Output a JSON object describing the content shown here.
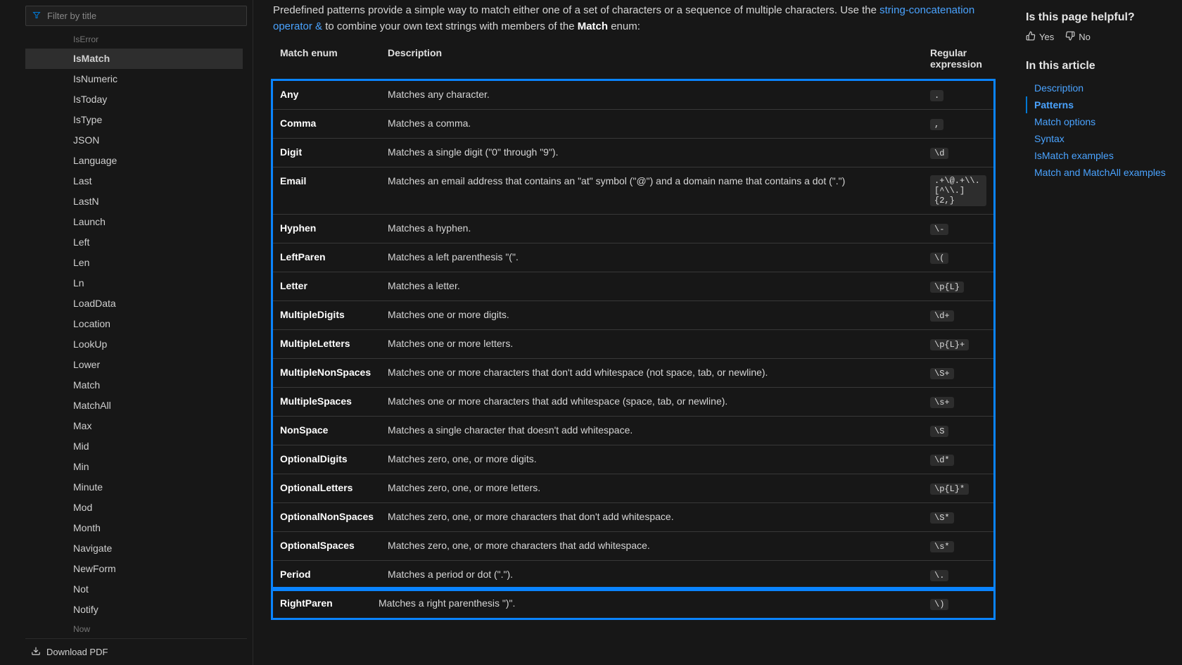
{
  "sidebar": {
    "filter_placeholder": "Filter by title",
    "items": [
      {
        "label": "IsError",
        "active": false,
        "partial": true
      },
      {
        "label": "IsMatch",
        "active": true
      },
      {
        "label": "IsNumeric"
      },
      {
        "label": "IsToday"
      },
      {
        "label": "IsType"
      },
      {
        "label": "JSON"
      },
      {
        "label": "Language"
      },
      {
        "label": "Last"
      },
      {
        "label": "LastN"
      },
      {
        "label": "Launch"
      },
      {
        "label": "Left"
      },
      {
        "label": "Len"
      },
      {
        "label": "Ln"
      },
      {
        "label": "LoadData"
      },
      {
        "label": "Location"
      },
      {
        "label": "LookUp"
      },
      {
        "label": "Lower"
      },
      {
        "label": "Match"
      },
      {
        "label": "MatchAll"
      },
      {
        "label": "Max"
      },
      {
        "label": "Mid"
      },
      {
        "label": "Min"
      },
      {
        "label": "Minute"
      },
      {
        "label": "Mod"
      },
      {
        "label": "Month"
      },
      {
        "label": "Navigate"
      },
      {
        "label": "NewForm"
      },
      {
        "label": "Not"
      },
      {
        "label": "Notify"
      },
      {
        "label": "Now",
        "partial": true
      }
    ],
    "download_label": "Download PDF"
  },
  "content": {
    "intro_pre": "Predefined patterns provide a simple way to match either one of a set of characters or a sequence of multiple characters. Use the ",
    "intro_link": "string-concatenation operator &",
    "intro_post_1": " to combine your own text strings with members of the ",
    "intro_bold": "Match",
    "intro_post_2": " enum:",
    "headers": {
      "enum": "Match enum",
      "desc": "Description",
      "regex": "Regular expression"
    },
    "rows": [
      {
        "enum": "Any",
        "desc": "Matches any character.",
        "regex": "."
      },
      {
        "enum": "Comma",
        "desc": "Matches a comma.",
        "regex": ","
      },
      {
        "enum": "Digit",
        "desc": "Matches a single digit (\"0\" through \"9\").",
        "regex": "\\d"
      },
      {
        "enum": "Email",
        "desc": "Matches an email address that contains an \"at\" symbol (\"@\") and a domain name that contains a dot (\".\")",
        "regex": ".+\\@.+\\\\.[^\\\\.]{2,}"
      },
      {
        "enum": "Hyphen",
        "desc": "Matches a hyphen.",
        "regex": "\\-"
      },
      {
        "enum": "LeftParen",
        "desc": "Matches a left parenthesis \"(\".",
        "regex": "\\("
      },
      {
        "enum": "Letter",
        "desc": "Matches a letter.",
        "regex": "\\p{L}"
      },
      {
        "enum": "MultipleDigits",
        "desc": "Matches one or more digits.",
        "regex": "\\d+"
      },
      {
        "enum": "MultipleLetters",
        "desc": "Matches one or more letters.",
        "regex": "\\p{L}+"
      },
      {
        "enum": "MultipleNonSpaces",
        "desc": "Matches one or more characters that don't add whitespace (not space, tab, or newline).",
        "regex": "\\S+"
      },
      {
        "enum": "MultipleSpaces",
        "desc": "Matches one or more characters that add whitespace (space, tab, or newline).",
        "regex": "\\s+"
      },
      {
        "enum": "NonSpace",
        "desc": "Matches a single character that doesn't add whitespace.",
        "regex": "\\S"
      },
      {
        "enum": "OptionalDigits",
        "desc": "Matches zero, one, or more digits.",
        "regex": "\\d*"
      },
      {
        "enum": "OptionalLetters",
        "desc": "Matches zero, one, or more letters.",
        "regex": "\\p{L}*"
      },
      {
        "enum": "OptionalNonSpaces",
        "desc": "Matches zero, one, or more characters that don't add whitespace.",
        "regex": "\\S*"
      },
      {
        "enum": "OptionalSpaces",
        "desc": "Matches zero, one, or more characters that add whitespace.",
        "regex": "\\s*"
      },
      {
        "enum": "Period",
        "desc": "Matches a period or dot (\".\").",
        "regex": "\\."
      }
    ],
    "outside_row": {
      "enum": "RightParen",
      "desc": "Matches a right parenthesis \")\".",
      "regex": "\\)"
    }
  },
  "rail": {
    "helpful_title": "Is this page helpful?",
    "yes": "Yes",
    "no": "No",
    "toc_title": "In this article",
    "toc": [
      {
        "label": "Description"
      },
      {
        "label": "Patterns",
        "active": true
      },
      {
        "label": "Match options"
      },
      {
        "label": "Syntax"
      },
      {
        "label": "IsMatch examples"
      },
      {
        "label": "Match and MatchAll examples"
      }
    ]
  }
}
